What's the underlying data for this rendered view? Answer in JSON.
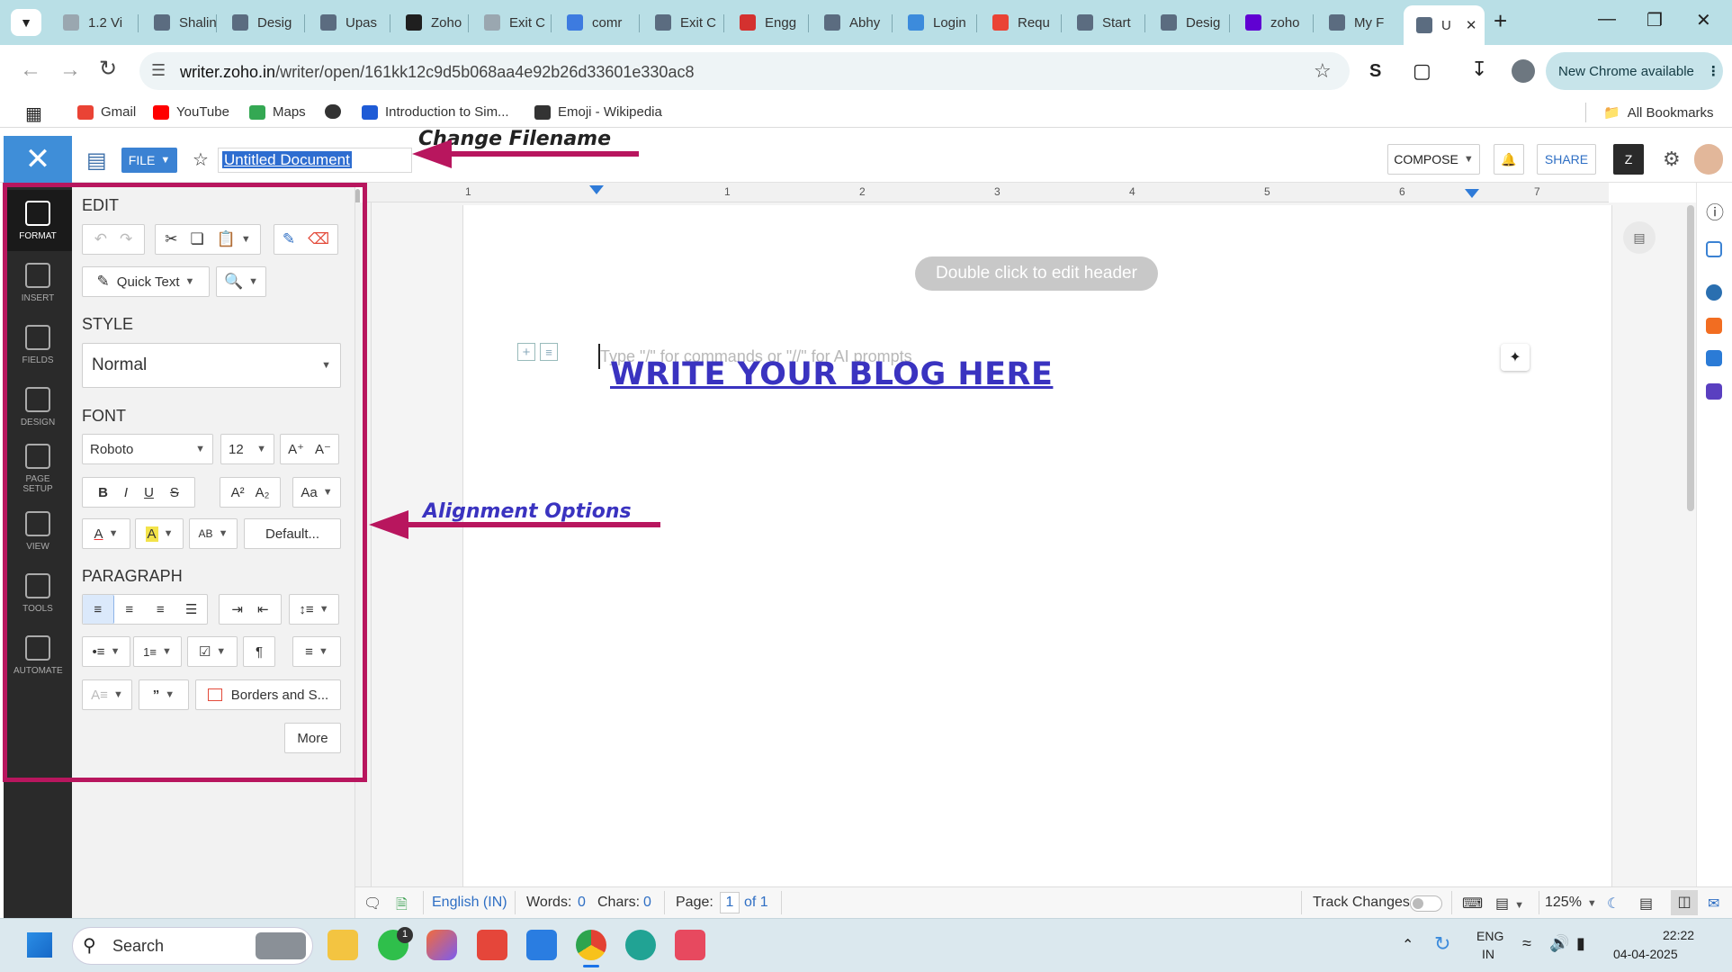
{
  "browser": {
    "tabs": [
      {
        "label": "1.2 Vi",
        "color": "#9aa7b0"
      },
      {
        "label": "Shalin",
        "color": "#5b6c80"
      },
      {
        "label": "Desig",
        "color": "#5b6c80"
      },
      {
        "label": "Upas",
        "color": "#5b6c80"
      },
      {
        "label": "Zoho",
        "color": "#1f1f1f"
      },
      {
        "label": "Exit C",
        "color": "#9aa7b0"
      },
      {
        "label": "comr",
        "color": "#3d7be0"
      },
      {
        "label": "Exit C",
        "color": "#5b6c80"
      },
      {
        "label": "Engg",
        "color": "#d4312f"
      },
      {
        "label": "Abhy",
        "color": "#5b6c80"
      },
      {
        "label": "Login",
        "color": "#3c8bdc"
      },
      {
        "label": "Requ",
        "color": "#ea4335"
      },
      {
        "label": "Start",
        "color": "#5b6c80"
      },
      {
        "label": "Desig",
        "color": "#5b6c80"
      },
      {
        "label": "zoho",
        "color": "#6001d2"
      },
      {
        "label": "My F",
        "color": "#5b6c80"
      },
      {
        "label": "U",
        "color": "#5b6c80"
      }
    ],
    "url_domain": "writer.zoho.in",
    "url_path": "/writer/open/161kk12c9d5b068aa4e92b26d33601e330ac8",
    "new_chrome": "New Chrome available",
    "bookmarks": [
      {
        "label": "Gmail",
        "color": "#ea4335"
      },
      {
        "label": "YouTube",
        "color": "#ff0000"
      },
      {
        "label": "Maps",
        "color": "#34a853"
      },
      {
        "label": "",
        "color": "#333333"
      },
      {
        "label": "Introduction to Sim...",
        "color": "#1e5bd6"
      },
      {
        "label": "Emoji - Wikipedia",
        "color": "#333333"
      }
    ],
    "all_bookmarks": "All Bookmarks"
  },
  "writer": {
    "file_label": "FILE",
    "doc_title": "Untitled Document",
    "compose_label": "COMPOSE",
    "share_label": "SHARE",
    "nav": [
      "FORMAT",
      "INSERT",
      "FIELDS",
      "DESIGN",
      "PAGE SETUP",
      "VIEW",
      "TOOLS",
      "AUTOMATE"
    ],
    "sections": {
      "edit": "EDIT",
      "style": "STYLE",
      "font": "FONT",
      "paragraph": "PARAGRAPH"
    },
    "quick_text": "Quick Text",
    "style_value": "Normal",
    "font_name": "Roboto",
    "font_size": "12",
    "default_label": "Default...",
    "borders_label": "Borders and S...",
    "more_label": "More",
    "header_hint": "Double click to edit header",
    "placeholder": "Type \"/\" for commands or \"//\" for AI prompts",
    "blog_text": "WRITE YOUR BLOG HERE",
    "ruler": [
      "1",
      "1",
      "2",
      "3",
      "4",
      "5",
      "6",
      "7"
    ],
    "status": {
      "language": "English (IN)",
      "words_label": "Words:",
      "words": "0",
      "chars_label": "Chars:",
      "chars": "0",
      "page_label": "Page:",
      "page": "1",
      "of_pages": "of 1",
      "track_changes": "Track Changes",
      "zoom": "125%"
    }
  },
  "annotations": {
    "change_filename": "Change Filename",
    "alignment": "Alignment Options",
    "color": "#b8165e"
  },
  "taskbar": {
    "search": "Search",
    "lang1": "ENG",
    "lang2": "IN",
    "time": "22:22",
    "date": "04-04-2025",
    "whatsapp_badge": "1"
  }
}
